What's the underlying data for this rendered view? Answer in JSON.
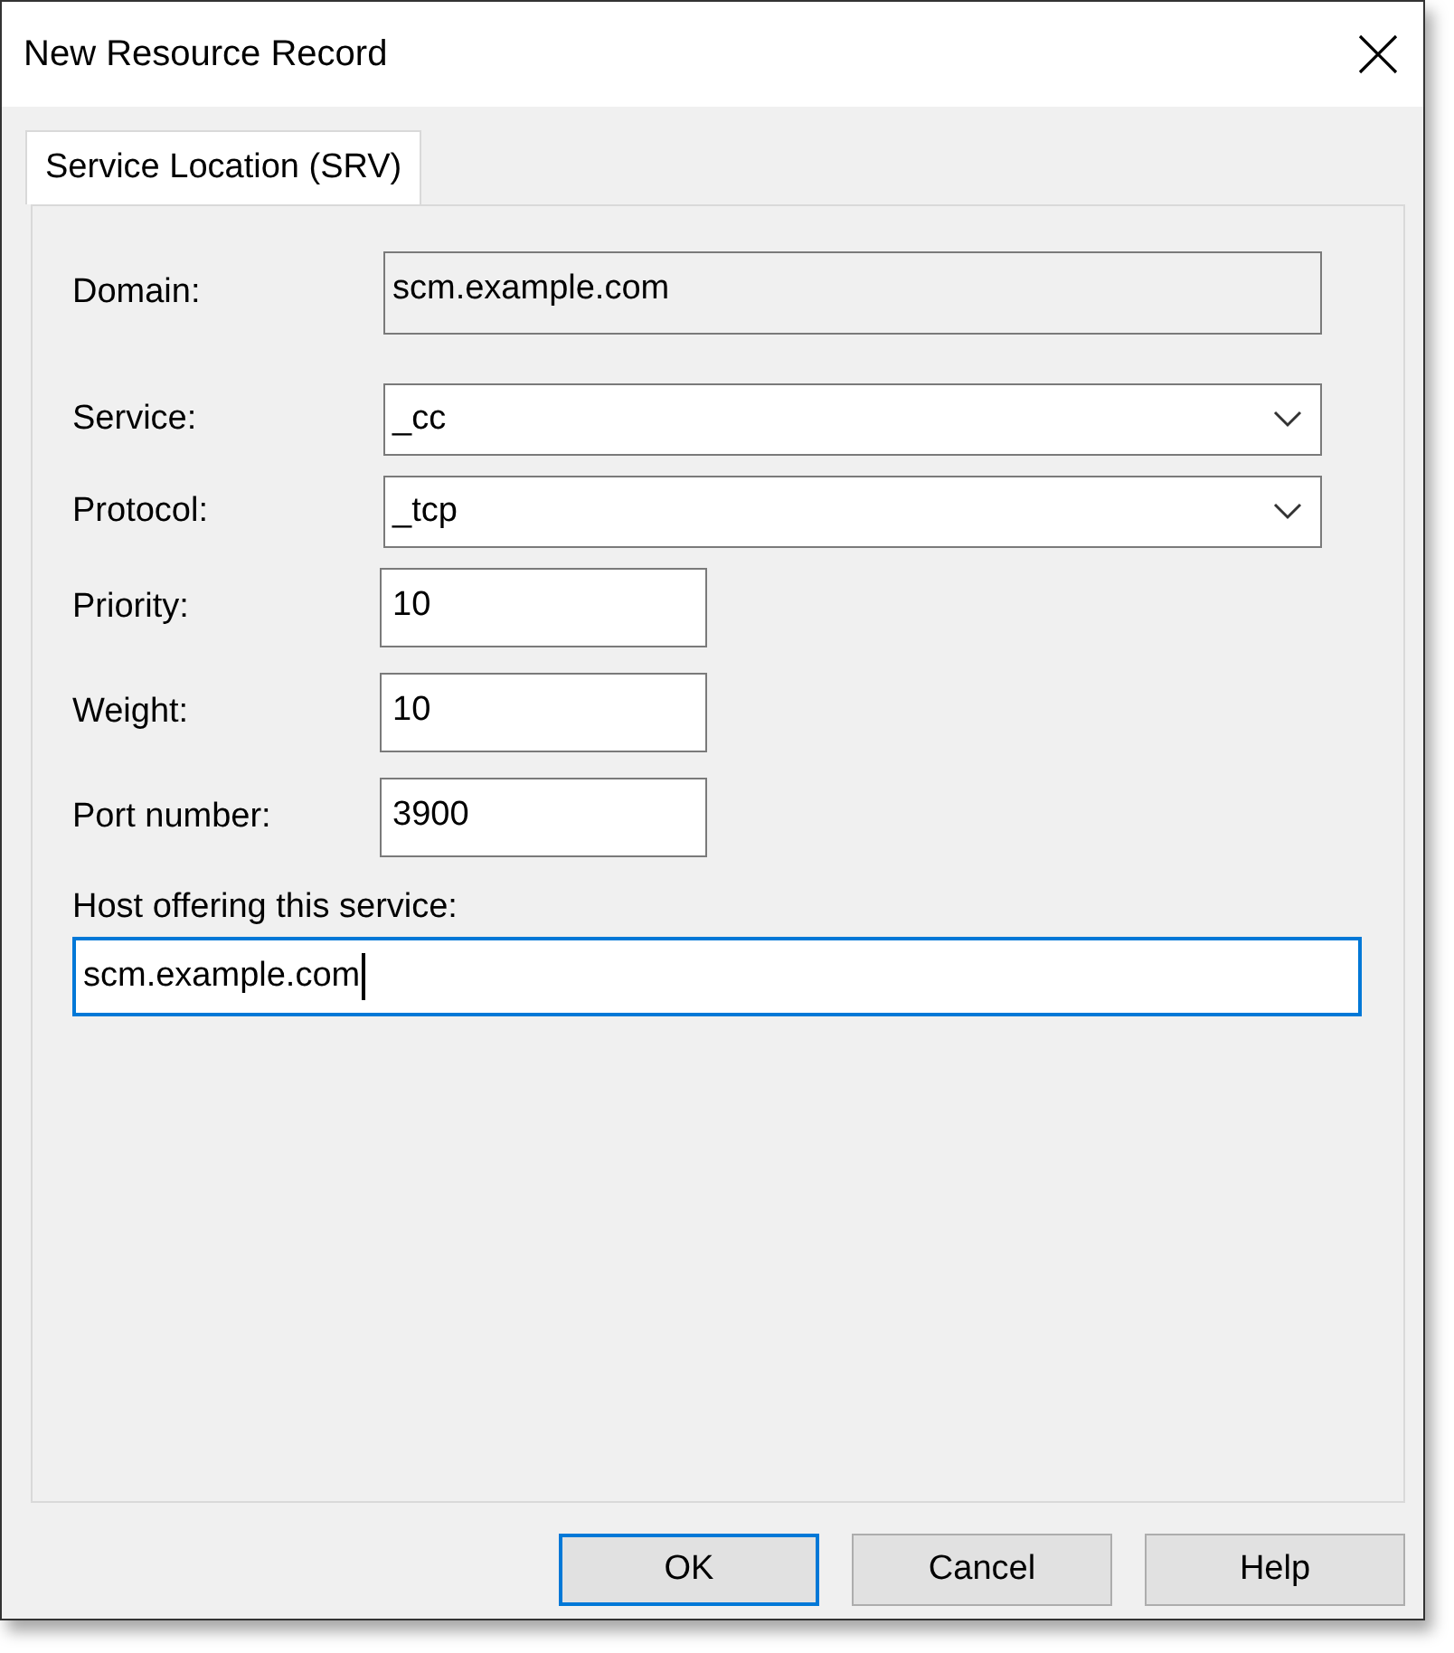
{
  "window": {
    "title": "New Resource Record"
  },
  "tabs": [
    {
      "label": "Service Location (SRV)",
      "selected": true
    }
  ],
  "fields": [
    {
      "kind": "readonly",
      "label": "Domain:",
      "value": "scm.example.com"
    },
    {
      "kind": "dropdown",
      "label": "Service:",
      "value": "_cc"
    },
    {
      "kind": "dropdown",
      "label": "Protocol:",
      "value": "_tcp"
    },
    {
      "kind": "short",
      "label": "Priority:",
      "value": "10"
    },
    {
      "kind": "short",
      "label": "Weight:",
      "value": "10"
    },
    {
      "kind": "short",
      "label": "Port number:",
      "value": "3900"
    },
    {
      "kind": "wide",
      "label": "Host offering this service:",
      "value": "scm.example.com",
      "focused": true
    }
  ],
  "buttons": [
    {
      "label": "OK",
      "default": true
    },
    {
      "label": "Cancel",
      "default": false
    },
    {
      "label": "Help",
      "default": false
    }
  ]
}
